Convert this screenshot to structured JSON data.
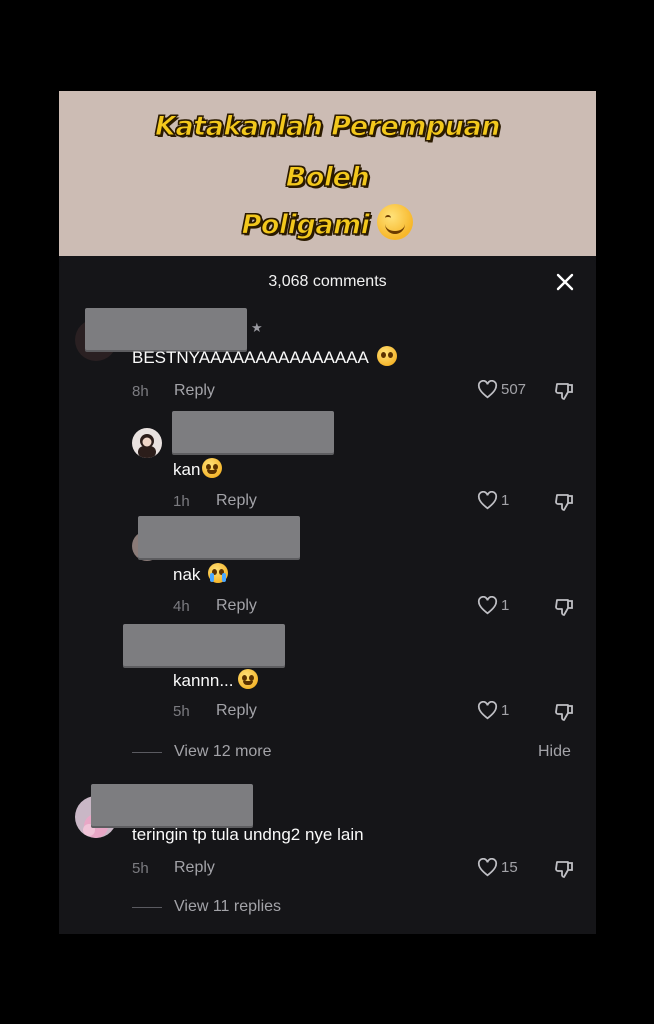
{
  "caption": {
    "line1": "Katakanlah Perempuan",
    "line2": "Boleh",
    "line3": "Poligami"
  },
  "sheet": {
    "title": "3,068 comments"
  },
  "comments": [
    {
      "text": "BESTNYAAAAAAAAAAAAAAA",
      "emoji": "pleading-face-icon",
      "time": "8h",
      "reply_label": "Reply",
      "likes": "507"
    },
    {
      "text": "kan",
      "emoji": "tears-of-joy-icon",
      "time": "1h",
      "reply_label": "Reply",
      "likes": "1"
    },
    {
      "text": "nak",
      "emoji": "loudly-crying-face-icon",
      "time": "4h",
      "reply_label": "Reply",
      "likes": "1"
    },
    {
      "text": "kannn...",
      "emoji": "grinning-face-icon",
      "time": "5h",
      "reply_label": "Reply",
      "likes": "1"
    },
    {
      "text": "teringin tp tula undng2 nye lain",
      "time": "5h",
      "reply_label": "Reply",
      "likes": "15"
    }
  ],
  "thread": {
    "view_more": "View 12 more",
    "hide": "Hide",
    "view_replies": "View 11 replies"
  },
  "colors": {
    "caption_yellow": "#f3c81c",
    "video_bg": "#ccbcb4",
    "sheet_bg": "#151518",
    "redaction": "#7d7d80"
  }
}
